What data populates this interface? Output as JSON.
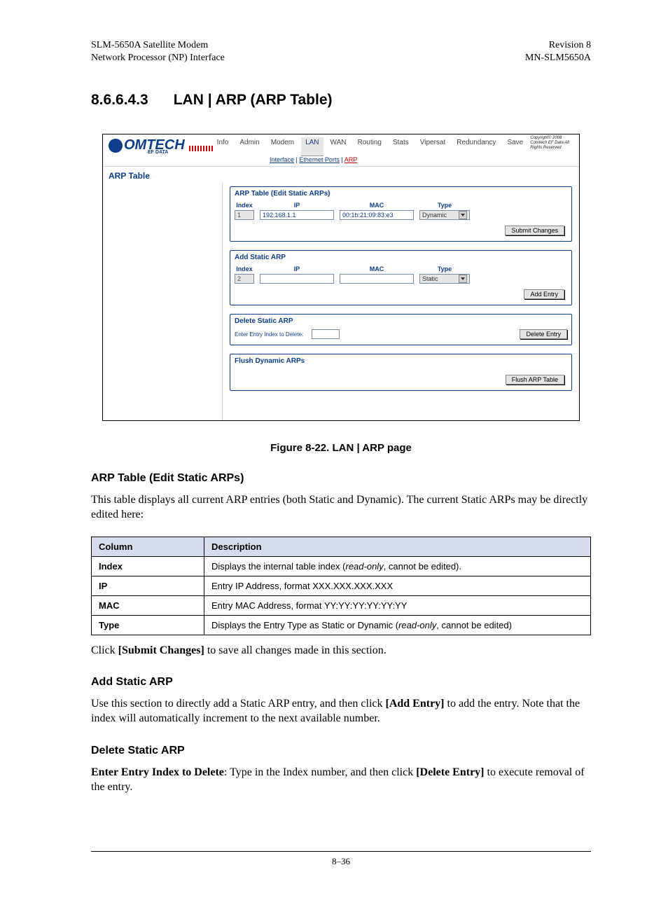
{
  "header": {
    "left1": "SLM-5650A Satellite Modem",
    "left2": "Network Processor (NP) Interface",
    "right1": "Revision 8",
    "right2": "MN-SLM5650A"
  },
  "section": {
    "number": "8.6.6.4.3",
    "title": "LAN | ARP (ARP Table)"
  },
  "screenshot": {
    "logo_text": "OMTECH",
    "logo_sub": "EF DATA",
    "tabs": [
      "Info",
      "Admin",
      "Modem",
      "LAN",
      "WAN",
      "Routing",
      "Stats",
      "Vipersat",
      "Redundancy",
      "Save"
    ],
    "tab_selected": "LAN",
    "subtabs": {
      "a": "Interface",
      "b": "Ethernet Ports",
      "c": "ARP"
    },
    "copyright": "Copyright© 2008 Comtech EF Data All Rights Reserved",
    "side_title": "ARP Table",
    "panel1": {
      "title": "ARP Table (Edit Static ARPs)",
      "hdr_index": "Index",
      "hdr_ip": "IP",
      "hdr_mac": "MAC",
      "hdr_type": "Type",
      "row_index": "1",
      "row_ip": "192.168.1.1",
      "row_mac": "00:1b:21:09:83:e3",
      "row_type": "Dynamic",
      "btn": "Submit Changes"
    },
    "panel2": {
      "title": "Add Static ARP",
      "hdr_index": "Index",
      "hdr_ip": "IP",
      "hdr_mac": "MAC",
      "hdr_type": "Type",
      "row_index": "2",
      "row_ip": "",
      "row_mac": "",
      "row_type": "Static",
      "btn": "Add Entry"
    },
    "panel3": {
      "title": "Delete Static ARP",
      "label": "Enter Entry Index to Delete:",
      "btn": "Delete Entry"
    },
    "panel4": {
      "title": "Flush Dynamic ARPs",
      "btn": "Flush ARP Table"
    }
  },
  "figure_caption": "Figure 8-22. LAN | ARP page",
  "s1": {
    "heading": "ARP Table (Edit Static ARPs)",
    "para": "This table displays all current ARP entries (both Static and Dynamic). The current Static ARPs may be directly edited here:"
  },
  "table": {
    "h1": "Column",
    "h2": "Description",
    "r1c1": "Index",
    "r1c2a": "Displays the internal table index (",
    "r1c2b": "read-only",
    "r1c2c": ", cannot be edited).",
    "r2c1": "IP",
    "r2c2": "Entry IP Address, format XXX.XXX.XXX.XXX",
    "r3c1": "MAC",
    "r3c2": "Entry MAC Address, format YY:YY:YY:YY:YY:YY",
    "r4c1": "Type",
    "r4c2a": "Displays the Entry Type as Static or Dynamic (",
    "r4c2b": "read-only",
    "r4c2c": ", cannot be edited)"
  },
  "p_submit_a": "Click ",
  "p_submit_b": "[Submit Changes]",
  "p_submit_c": " to save all changes made in this section.",
  "s2": {
    "heading": "Add Static ARP",
    "para_a": "Use this section to directly add a Static ARP entry, and then click ",
    "para_b": "[Add Entry]",
    "para_c": " to add the entry. Note that the index will automatically increment to the next available number."
  },
  "s3": {
    "heading": "Delete Static ARP",
    "para_a": "Enter Entry Index to Delete",
    "para_b": ": Type in the Index number, and then click ",
    "para_c": "[Delete Entry]",
    "para_d": " to execute removal of the entry."
  },
  "footer": "8–36"
}
